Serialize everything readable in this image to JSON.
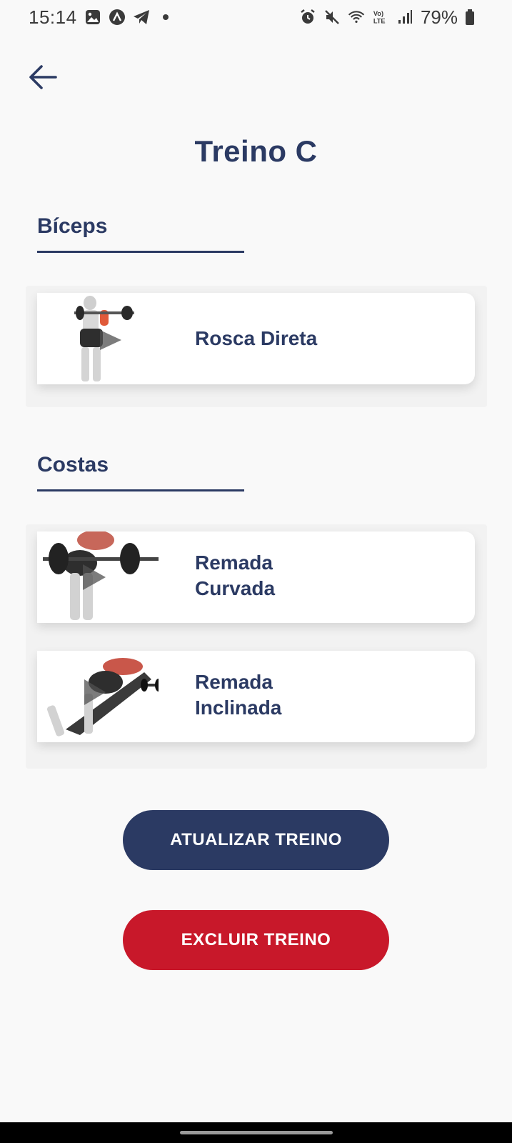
{
  "status_bar": {
    "time": "15:14",
    "battery": "79%",
    "icons_left": [
      "gallery-icon",
      "app-icon",
      "telegram-icon",
      "dot-icon"
    ],
    "icons_right": [
      "alarm-icon",
      "mute-icon",
      "wifi-icon",
      "volte-icon",
      "signal-icon",
      "battery-icon"
    ]
  },
  "header": {
    "back_icon": "arrow-left-icon",
    "title": "Treino C"
  },
  "sections": [
    {
      "title": "Bíceps",
      "exercises": [
        {
          "name": "Rosca Direta",
          "line1": "Rosca Direta",
          "line2": ""
        }
      ]
    },
    {
      "title": "Costas",
      "exercises": [
        {
          "name": "Remada Curvada",
          "line1": "Remada",
          "line2": "Curvada"
        },
        {
          "name": "Remada Inclinada",
          "line1": "Remada",
          "line2": "Inclinada"
        }
      ]
    }
  ],
  "actions": {
    "update_label": "ATUALIZAR TREINO",
    "delete_label": "EXCLUIR TREINO"
  },
  "colors": {
    "primary": "#2b3a63",
    "danger": "#c8182a",
    "background": "#f9f9f9"
  }
}
